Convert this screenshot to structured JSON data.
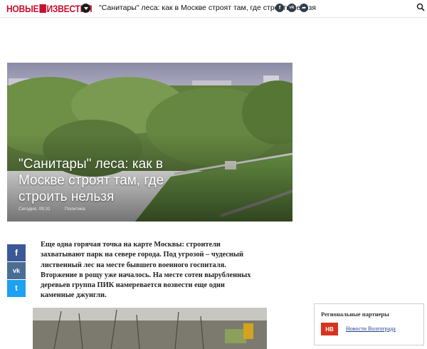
{
  "header": {
    "logo_left": "НОВЫЕ",
    "logo_right": "ИЗВЕСТИЯ",
    "title": "\"Санитары\" леса: как в Москве строят там, где строить нельзя",
    "social": [
      {
        "icon": "facebook-icon",
        "glyph": "f",
        "color": "#2f3b4b"
      },
      {
        "icon": "vk-icon",
        "glyph": "vk",
        "color": "#2f3b4b"
      },
      {
        "icon": "share-icon",
        "glyph": "➦",
        "color": "#2f3b4b"
      }
    ]
  },
  "hero": {
    "title": "\"Санитары\" леса: как в Москве строят там, где строить нельзя",
    "date": "Сегодня, 09:31",
    "category": "Политика"
  },
  "share_bar": [
    {
      "icon": "facebook-icon",
      "glyph": "f",
      "color": "#3b5998"
    },
    {
      "icon": "vk-icon",
      "glyph": "vk",
      "color": "#4a6d93"
    },
    {
      "icon": "twitter-icon",
      "glyph": "t",
      "color": "#1da1f2"
    }
  ],
  "article": {
    "lead": "Еще одна горячая точка на карте Москвы: строители захватывают парк на севере города. Под угрозой – чудесный лиственный лес на месте бывшего военного госпиталя. Вторжение в рощу уже началось. На месте сотен вырубленных деревьев группа ПИК намеревается возвести еще одни каменные джунгли."
  },
  "partners": {
    "heading": "Региональные партнеры",
    "logo_text": "НВ",
    "link": "Новости Волгограда"
  }
}
